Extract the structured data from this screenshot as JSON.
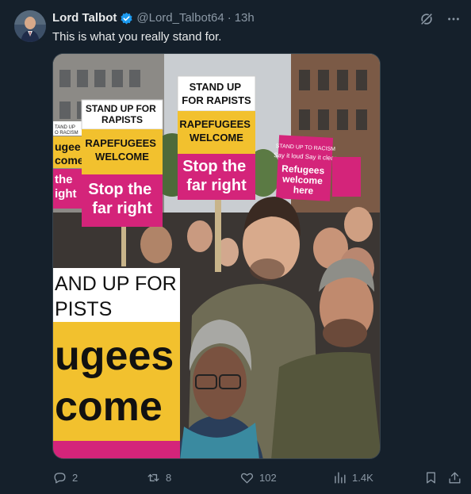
{
  "tweet": {
    "author_name": "Lord Talbot",
    "handle": "@Lord_Talbot64",
    "separator": "·",
    "time": "13h",
    "text": "This is what you really stand for."
  },
  "signs": {
    "left_partial_1": "TAND UP",
    "left_partial_2": "O RACISM",
    "left_partial_3": "ugee",
    "left_partial_4": "come",
    "left_partial_5": "the",
    "left_partial_6": "ight",
    "sign1_top": "STAND UP FOR RAPISTS",
    "sign1_mid": "RAPEFUGEES WELCOME",
    "sign1_bottom": "Stop the far right",
    "sign2_top": "STAND UP FOR RAPISTS",
    "sign2_mid": "RAPEFUGEES WELCOME",
    "sign2_bottom": "Stop the far right",
    "sign3_top": "STAND UP TO RACISM",
    "sign3_mid": "Say it loud Say it clear",
    "sign3_bottom": "Refugees welcome here",
    "big_top_1": "AND UP FOR",
    "big_top_2": "PISTS",
    "big_mid_1": "ugees",
    "big_mid_2": "come"
  },
  "actions": {
    "reply_count": "2",
    "retweet_count": "8",
    "like_count": "102",
    "views_count": "1.4K"
  },
  "colors": {
    "background": "#15202b",
    "text_primary": "#e7e9ea",
    "text_secondary": "#8b98a5",
    "verified_blue": "#1d9bf0",
    "sign_yellow": "#f2c12e",
    "sign_pink": "#d4247a"
  },
  "icons": {
    "verified": "verified-badge-icon",
    "grok": "grok-icon",
    "more": "more-icon",
    "reply": "reply-icon",
    "retweet": "retweet-icon",
    "like": "heart-icon",
    "views": "views-icon",
    "bookmark": "bookmark-icon",
    "share": "share-icon"
  }
}
